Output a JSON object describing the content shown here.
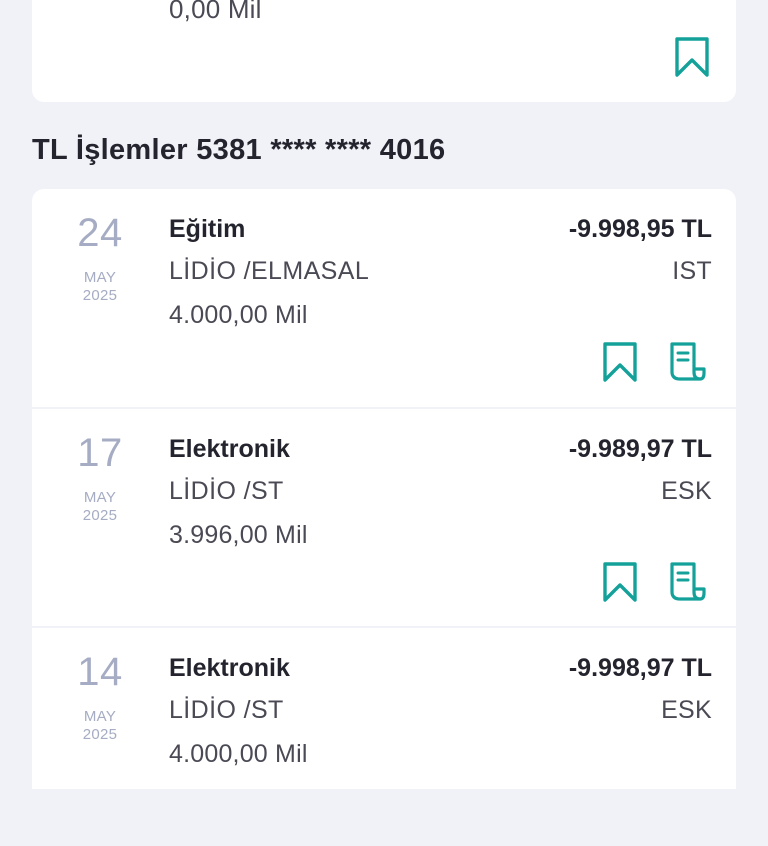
{
  "previous_card": {
    "miles": "0,00 Mil"
  },
  "section": {
    "title": "TL İşlemler 5381 **** **** 4016"
  },
  "transactions": [
    {
      "day": "24",
      "month": "MAY",
      "year": "2025",
      "category": "Eğitim",
      "merchant": "LİDİO  /ELMASAL",
      "miles": "4.000,00 Mil",
      "amount": "-9.998,95 TL",
      "city": "IST"
    },
    {
      "day": "17",
      "month": "MAY",
      "year": "2025",
      "category": "Elektronik",
      "merchant": "LİDİO  /ST",
      "miles": "3.996,00 Mil",
      "amount": "-9.989,97 TL",
      "city": "ESK"
    },
    {
      "day": "14",
      "month": "MAY",
      "year": "2025",
      "category": "Elektronik",
      "merchant": "LİDİO  /ST",
      "miles": "4.000,00 Mil",
      "amount": "-9.998,97 TL",
      "city": "ESK"
    }
  ],
  "icons": {
    "bookmark": "bookmark-icon",
    "receipt": "receipt-icon"
  },
  "colors": {
    "accent": "#14a19a",
    "background": "#f1f2f7",
    "date_gray": "#a5acc3"
  }
}
